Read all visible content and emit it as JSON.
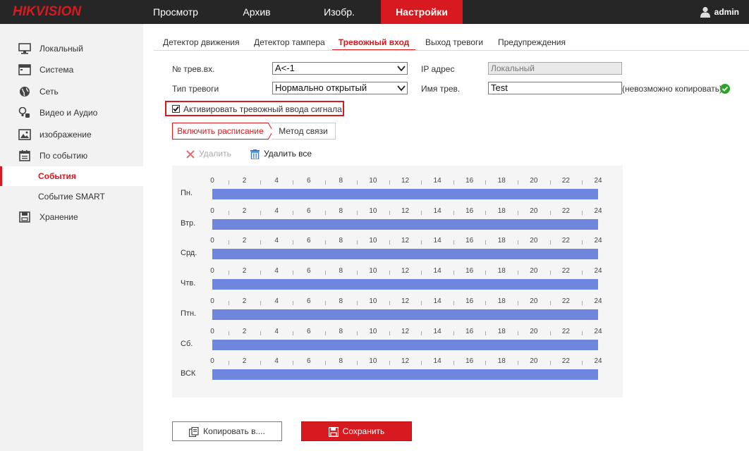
{
  "header": {
    "logo": "HIKVISION",
    "nav": [
      "Просмотр",
      "Архив",
      "Изобр.",
      "Настройки"
    ],
    "active_nav": "Настройки",
    "user": "admin"
  },
  "sidebar": {
    "items": [
      {
        "label": "Локальный",
        "icon": "monitor-icon"
      },
      {
        "label": "Система",
        "icon": "system-icon"
      },
      {
        "label": "Сеть",
        "icon": "globe-icon"
      },
      {
        "label": "Видео и Аудио",
        "icon": "video-audio-icon"
      },
      {
        "label": "изображение",
        "icon": "image-icon"
      },
      {
        "label": "По событию",
        "icon": "calendar-icon"
      },
      {
        "label": "События",
        "icon": ""
      },
      {
        "label": "Событие SMART",
        "icon": ""
      },
      {
        "label": "Хранение",
        "icon": "storage-icon"
      }
    ],
    "active_item": "События"
  },
  "tabs": [
    "Детектор движения",
    "Детектор тампера",
    "Тревожный вход",
    "Выход тревоги",
    "Предупреждения"
  ],
  "active_tab": "Тревожный вход",
  "form": {
    "alarm_input_label": "№ трев.вх.",
    "alarm_input_value": "A<-1",
    "ip_label": "IP адрес",
    "ip_value": "Локальный",
    "alarm_type_label": "Тип тревоги",
    "alarm_type_value": "Нормально открытый",
    "alarm_name_label": "Имя трев.",
    "alarm_name_value": "Test",
    "copy_note": "(невозможно копировать)",
    "enable_label": "Активировать тревожный ввода сигнала",
    "enable_checked": true
  },
  "subtabs": [
    "Включить расписание",
    "Метод связи"
  ],
  "actions": {
    "delete": "Удалить",
    "delete_all": "Удалить все"
  },
  "schedule": {
    "ticks": [
      "0",
      "2",
      "4",
      "6",
      "8",
      "10",
      "12",
      "14",
      "16",
      "18",
      "20",
      "22",
      "24"
    ],
    "days": [
      {
        "label": "Пн.",
        "start": 0,
        "end": 24
      },
      {
        "label": "Втр.",
        "start": 0,
        "end": 24
      },
      {
        "label": "Срд.",
        "start": 0,
        "end": 24
      },
      {
        "label": "Чтв.",
        "start": 0,
        "end": 24
      },
      {
        "label": "Птн.",
        "start": 0,
        "end": 24
      },
      {
        "label": "Сб.",
        "start": 0,
        "end": 24
      },
      {
        "label": "ВСК",
        "start": 0,
        "end": 24
      }
    ],
    "bar_color": "#6f86df"
  },
  "buttons": {
    "copy": "Копировать в....",
    "save": "Сохранить"
  },
  "colors": {
    "accent": "#d71920",
    "topbar": "#262626",
    "ok": "#2aa52a"
  }
}
